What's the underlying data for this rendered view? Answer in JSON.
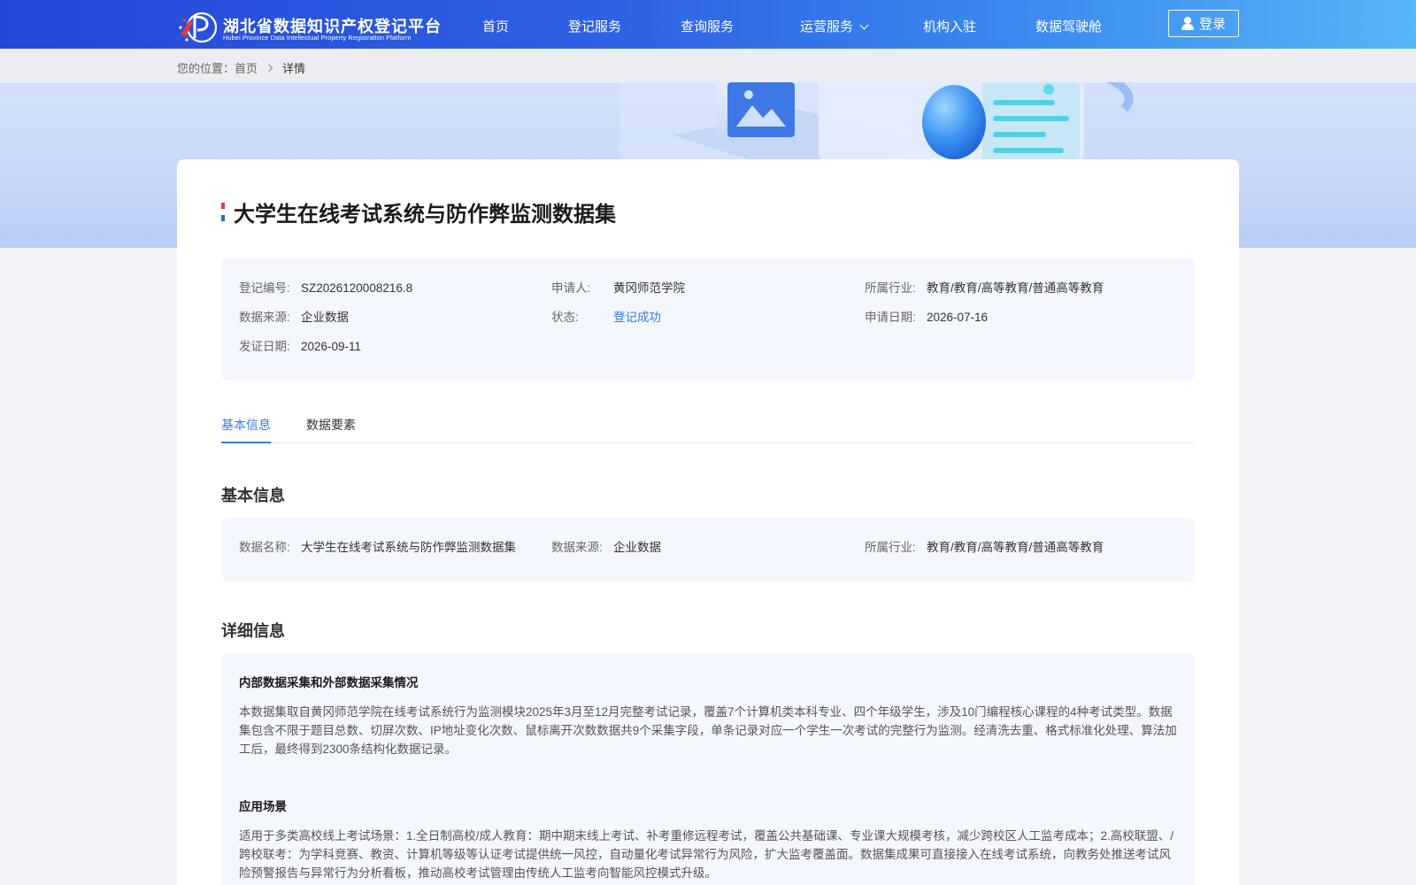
{
  "header": {
    "logo_title": "湖北省数据知识产权登记平台",
    "logo_subtitle": "Hubei Province Data Intellectual Property Registration Platform",
    "nav": [
      "首页",
      "登记服务",
      "查询服务",
      "运营服务",
      "机构入驻",
      "数据驾驶舱"
    ],
    "login_label": "登录"
  },
  "breadcrumb": {
    "prefix": "您的位置：",
    "home": "首页",
    "current": "详情"
  },
  "detail": {
    "title": "大学生在线考试系统与防作弊监测数据集",
    "summary": {
      "reg_no_label": "登记编号:",
      "reg_no": "SZ2026120008216.8",
      "applicant_label": "申请人:",
      "applicant": "黄冈师范学院",
      "industry_label": "所属行业:",
      "industry": "教育/教育/高等教育/普通高等教育",
      "source_label": "数据来源:",
      "source": "企业数据",
      "status_label": "状态:",
      "status": "登记成功",
      "apply_date_label": "申请日期:",
      "apply_date": "2026-07-16",
      "issue_date_label": "发证日期:",
      "issue_date": "2026-09-11"
    },
    "tabs": [
      "基本信息",
      "数据要素"
    ],
    "basic": {
      "heading": "基本信息",
      "name_label": "数据名称:",
      "name": "大学生在线考试系统与防作弊监测数据集",
      "source_label": "数据来源:",
      "source": "企业数据",
      "industry_label": "所属行业:",
      "industry": "教育/教育/高等教育/普通高等教育"
    },
    "more": {
      "heading": "详细信息",
      "collection_title": "内部数据采集和外部数据采集情况",
      "collection_text": "本数据集取自黄冈师范学院在线考试系统行为监测模块2025年3月至12月完整考试记录，覆盖7个计算机类本科专业、四个年级学生，涉及10门编程核心课程的4种考试类型。数据集包含不限于题目总数、切屏次数、IP地址变化次数、鼠标离开次数数据共9个采集字段，单条记录对应一个学生一次考试的完整行为监测。经清洗去重、格式标准化处理、算法加工后，最终得到2300条结构化数据记录。",
      "scenario_title": "应用场景",
      "scenario_text": "适用于多类高校线上考试场景：1.全日制高校/成人教育：期中期末线上考试、补考重修远程考试，覆盖公共基础课、专业课大规模考核，减少跨校区人工监考成本；2.高校联盟、/跨校联考：为学科竞赛、教资、计算机等级等认证考试提供统一风控，自动量化考试异常行为风险，扩大监考覆盖面。数据集成果可直接接入在线考试系统，向教务处推送考试风险预警报告与异常行为分析看板，推动高校考试管理由传统人工监考向智能风控模式升级。"
    }
  },
  "colors": {
    "header_start": "#2447d8",
    "header_end": "#55b6f6",
    "accent": "#2f7be8",
    "title_mark_top": "#e23b3b",
    "title_mark_bottom": "#2f64d8"
  }
}
